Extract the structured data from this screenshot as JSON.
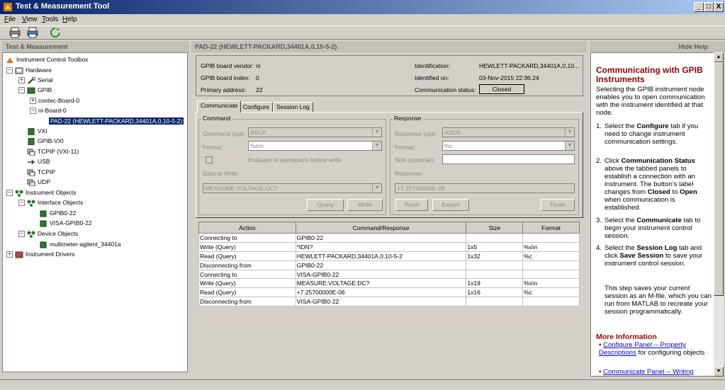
{
  "window": {
    "title": "Test & Measurement Tool",
    "minimize": "_",
    "maximize": "□",
    "close": "X"
  },
  "menu": [
    {
      "first": "F",
      "rest": "ile"
    },
    {
      "first": "V",
      "rest": "iew"
    },
    {
      "first": "T",
      "rest": "ools"
    },
    {
      "first": "H",
      "rest": "elp"
    }
  ],
  "left_header": "Test & Measurement",
  "center_header": "PAD-22 (HEWLETT-PACKARD,34401A,0,10-5-2)",
  "hide_help": "Hide Help",
  "tree": {
    "root": "Instrument Control Toolbox",
    "hardware": "Hardware",
    "serial": "Serial",
    "gpib": "GPIB",
    "contec": "contec-Board-0",
    "ni": "ni-Board-0",
    "pad": "PAD-22 (HEWLETT-PACKARD,34401A,0,10-5-2)",
    "vxi": "VXI",
    "gpibvxi": "GPIB-VXI",
    "tcpipvxi": "TCPIP (VXI-11)",
    "usb": "USB",
    "tcpip": "TCPIP",
    "udp": "UDP",
    "instobjs": "Instrument Objects",
    "ifobjs": "Interface Objects",
    "gpib0": "GPIB0-22",
    "visagpib": "VISA-GPIB0-22",
    "devobjs": "Device Objects",
    "mm": "multimeter-agilent_34401a",
    "drivers": "Instrument Drivers"
  },
  "info": {
    "vendor_label": "GPIB board vendor:",
    "vendor": "ni",
    "index_label": "GPIB board index:",
    "index": "0",
    "primary_label": "Primary address:",
    "primary": "22",
    "ident_label": "Identification:",
    "ident": "HEWLETT-PACKARD,34401A,0,10...",
    "identon_label": "Identified on:",
    "identon": "03-Nov-2015 22:36:24",
    "status_label": "Communication status:",
    "status": "Closed"
  },
  "tabs": [
    "Communicate",
    "Configure",
    "Session Log"
  ],
  "command": {
    "group": "Command",
    "type_label": "Command type:",
    "type": "ASCII",
    "format_label": "Format:",
    "format": "%s\\n",
    "eval_label": "Evaluate in workspace before write",
    "data_label": "Data to Write:",
    "data": "MEASURE:VOLTAGE:DC?",
    "query": "Query",
    "write": "Write"
  },
  "response": {
    "group": "Response",
    "type_label": "Response type:",
    "type": "ASCII",
    "format_label": "Format:",
    "format": "%c",
    "size_label": "Size (optional):",
    "resp_label": "Response:",
    "resp": "+7.25700000E-06",
    "read": "Read",
    "export": "Export",
    "flush": "Flush"
  },
  "table": {
    "headers": [
      "Action",
      "Command/Response",
      "Size",
      "Format"
    ],
    "rows": [
      [
        "Connecting to",
        "GPIB0-22",
        "",
        ""
      ],
      [
        "Write (Query)",
        "*IDN?",
        "1x5",
        "%s\\n"
      ],
      [
        "Read (Query)",
        "HEWLETT-PACKARD,34401A,0,10-5-2",
        "1x32",
        "%c"
      ],
      [
        "Disconnecting from",
        "GPIB0-22",
        "",
        ""
      ],
      [
        "Connecting to",
        "VISA-GPIB0-22",
        "",
        ""
      ],
      [
        "Write (Query)",
        "MEASURE:VOLTAGE:DC?",
        "1x19",
        "%s\\n"
      ],
      [
        "Read (Query)",
        "+7.25700000E-06",
        "1x16",
        "%c"
      ],
      [
        "Disconnecting from",
        "VISA-GPIB0-22",
        "",
        ""
      ]
    ]
  },
  "help": {
    "title": "Communicating with GPIB Instruments",
    "intro": "Selecting the GPIB instrument node enables you to open communication with the instrument identified at that node.",
    "s1_num": "1.",
    "s1_a": "Select the",
    "s1_b": "Configure",
    "s1_c": "tab if you need to change instrument communication settings.",
    "s2_num": "2.",
    "s2_a": "Click",
    "s2_b": "Communication Status",
    "s2_c": "above the tabbed panels to establish a connection with an instrument. The button's label changes from",
    "s2_d": "Closed",
    "s2_e": "to",
    "s2_f": "Open",
    "s2_g": "when communication is established.",
    "s3_num": "3.",
    "s3_a": "Select the",
    "s3_b": "Communicate",
    "s3_c": "tab to begin your instrument control session.",
    "s4_num": "4.",
    "s4_a": "Select the",
    "s4_b": "Session Log",
    "s4_c": "tab and click",
    "s4_d": "Save Session",
    "s4_e": "to save your instrument control session.",
    "note": "This step saves your current session as an M-file, which you can run from MATLAB to recreate your session programmatically.",
    "more": "More Information",
    "link1": "Configure Panel -- Property Descriptions",
    "link1_rest": "for configuring objects",
    "link2": "Communicate Panel -- Writing"
  },
  "colors": {
    "titlebar": "#0a246a",
    "help_title": "#990000",
    "selection": "#0a246a"
  }
}
